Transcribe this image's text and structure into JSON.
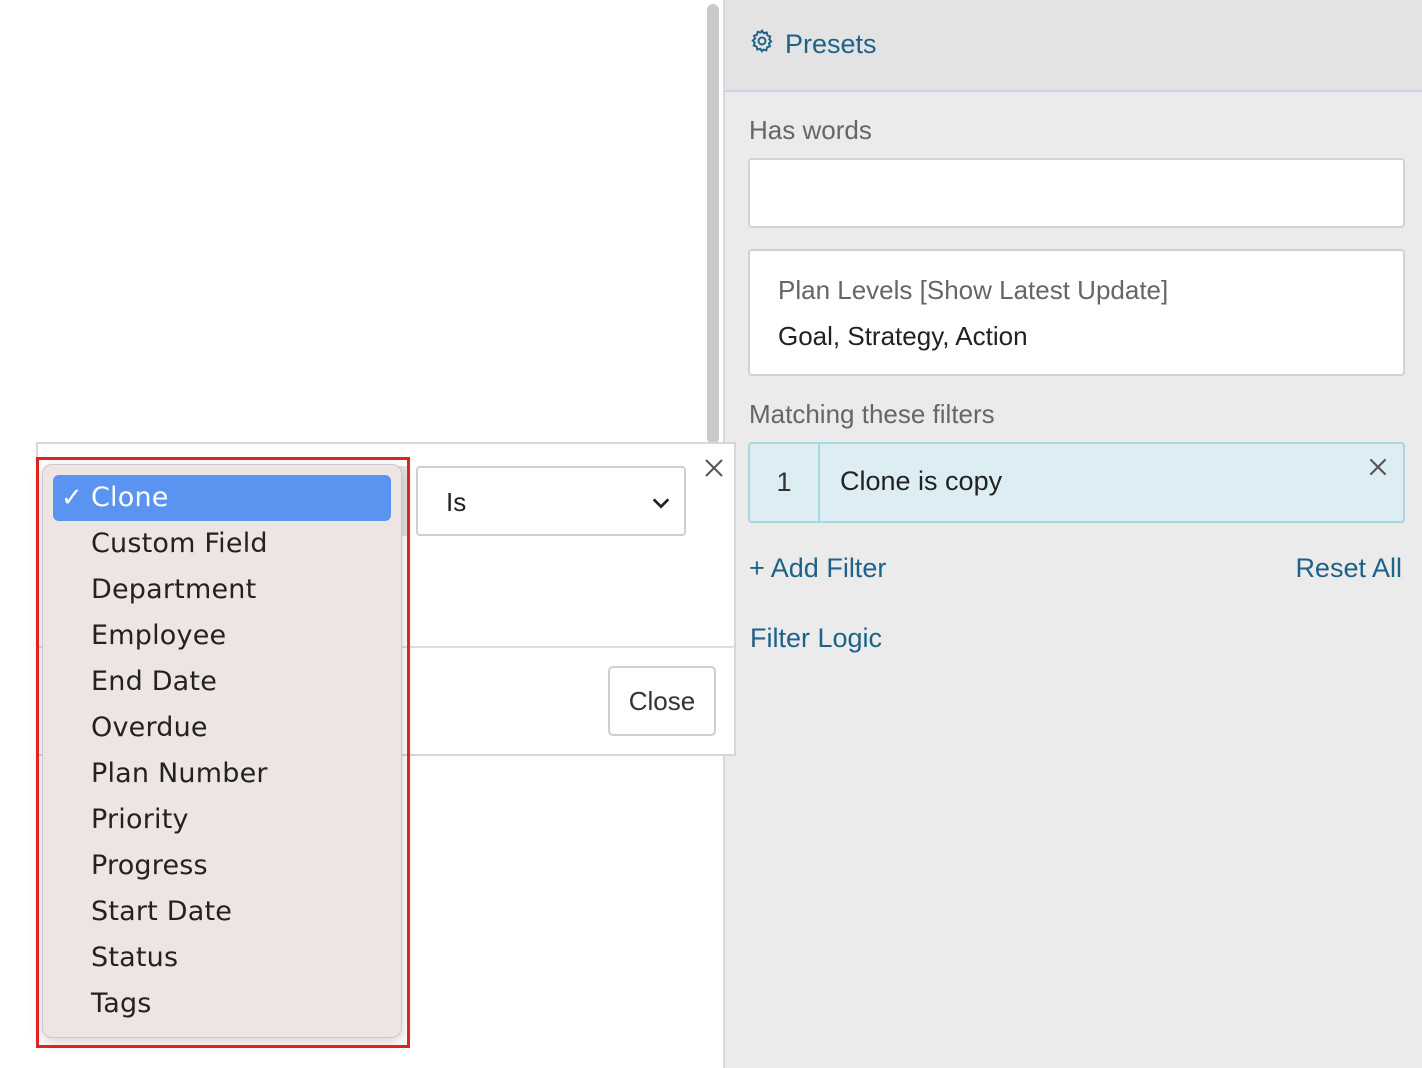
{
  "panel": {
    "presets_label": "Presets",
    "has_words_label": "Has words",
    "has_words_value": "",
    "plan_levels_title": "Plan Levels [Show Latest Update]",
    "plan_levels_value": "Goal, Strategy, Action",
    "matching_label": "Matching these filters",
    "filters": [
      {
        "number": "1",
        "text": "Clone is copy"
      }
    ],
    "add_filter": "+ Add Filter",
    "reset_all": "Reset All",
    "filter_logic": "Filter Logic"
  },
  "popover": {
    "operator_value": "Is",
    "close_label": "Close"
  },
  "dropdown": {
    "check_mark": "✓",
    "items": [
      "Clone",
      "Custom Field",
      "Department",
      "Employee",
      "End Date",
      "Overdue",
      "Plan Number",
      "Priority",
      "Progress",
      "Start Date",
      "Status",
      "Tags"
    ],
    "selected": "Clone"
  },
  "colors": {
    "link": "#1d6288",
    "selected_item": "#5b93f0",
    "highlight": "#e02222",
    "filter_chip": "#dceef4"
  }
}
